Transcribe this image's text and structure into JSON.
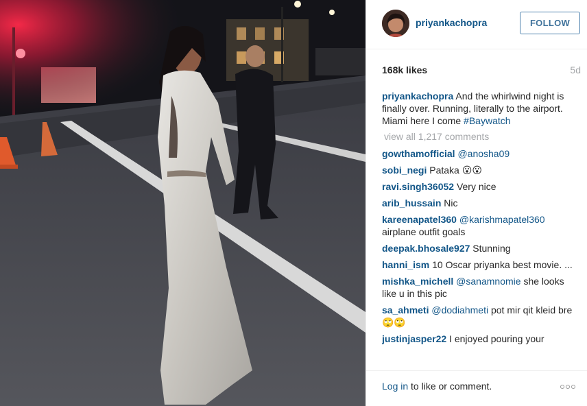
{
  "post": {
    "author": "priyankachopra",
    "follow_label": "FOLLOW",
    "likes": "168k likes",
    "age": "5d",
    "caption": {
      "user": "priyankachopra",
      "text": "And the whirlwind night is finally over. Running, literally to the airport. Miami here I come",
      "hashtag": "#Baywatch"
    },
    "view_all_label": "view all 1,217 comments",
    "comments": [
      {
        "user": "gowthamofficial",
        "mention": "@anosha09",
        "text": ""
      },
      {
        "user": "sobi_negi",
        "mention": "",
        "text": "Pataka 😮😮"
      },
      {
        "user": "ravi.singh36052",
        "mention": "",
        "text": "Very nice"
      },
      {
        "user": "arib_hussain",
        "mention": "",
        "text": "Nic"
      },
      {
        "user": "kareenapatel360",
        "mention": "@karishmapatel360",
        "text": "airplane outfit goals"
      },
      {
        "user": "deepak.bhosale927",
        "mention": "",
        "text": "Stunning"
      },
      {
        "user": "hanni_ism",
        "mention": "",
        "text": "10 Oscar priyanka best movie. ..."
      },
      {
        "user": "mishka_michell",
        "mention": "@sanamnomie",
        "text": "she looks like u in this pic"
      },
      {
        "user": "sa_ahmeti",
        "mention": "@dodiahmeti",
        "text": "pot mir qit kleid bre 🙄🙄"
      },
      {
        "user": "justinjasper22",
        "mention": "",
        "text": "I enjoyed pouring your"
      }
    ]
  },
  "footer": {
    "login_link": "Log in",
    "login_rest": " to like or comment."
  },
  "icons": {
    "more": "more-options-icon"
  },
  "colors": {
    "link": "#125688",
    "follow_text": "#3f729b",
    "muted": "#a5a7aa",
    "text": "#262626"
  }
}
